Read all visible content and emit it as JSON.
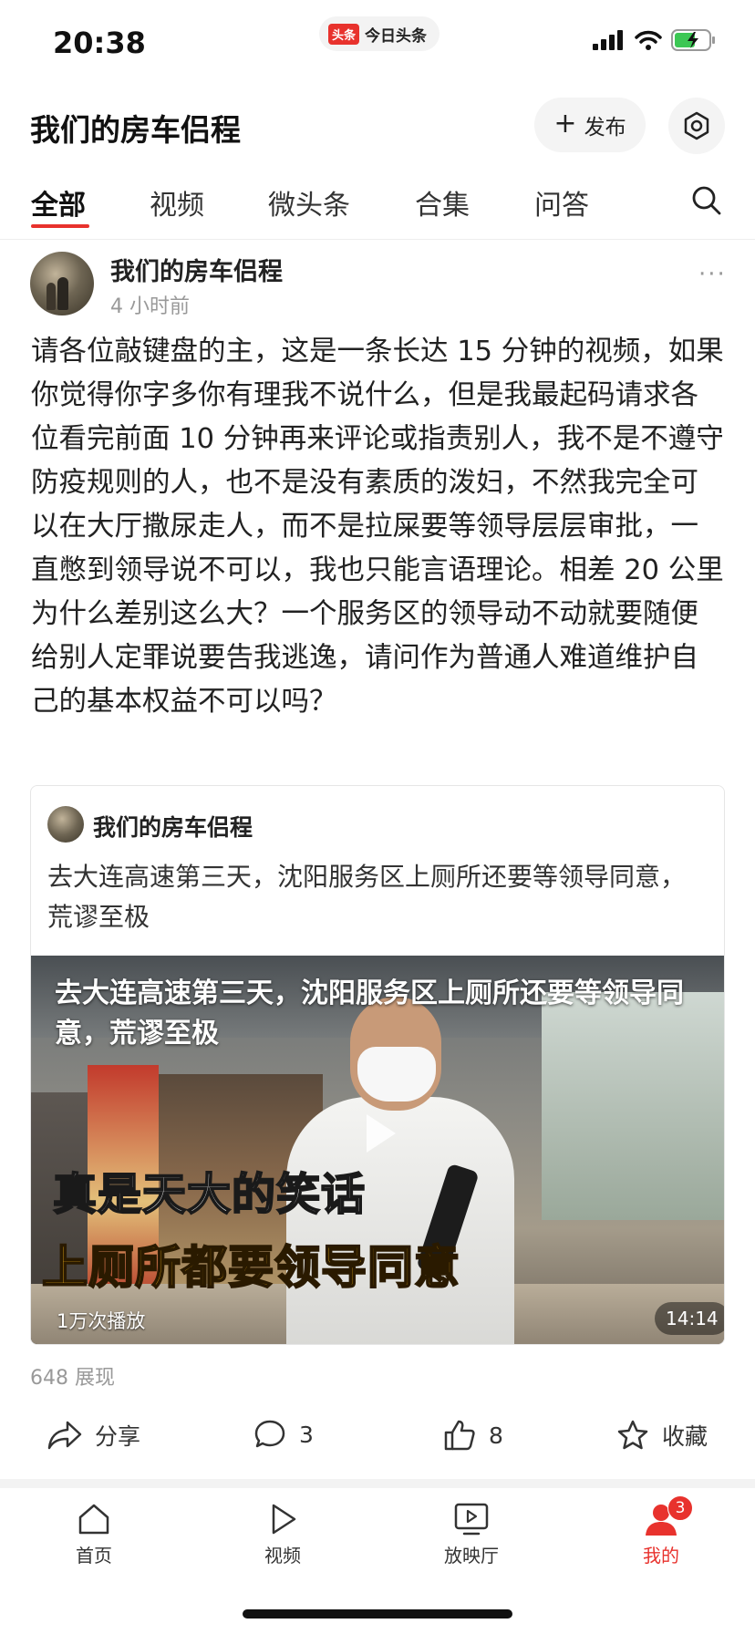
{
  "status_bar": {
    "time": "20:38",
    "app_logo": "头条",
    "app_name": "今日头条",
    "icons": [
      "signal-icon",
      "wifi-icon",
      "battery-charging-icon"
    ]
  },
  "header": {
    "title": "我们的房车侣程",
    "publish_label": "发布",
    "publish_icon": "plus-icon",
    "settings_icon": "hexagon-settings-icon"
  },
  "tabs": {
    "items": [
      {
        "label": "全部",
        "active": true
      },
      {
        "label": "视频",
        "active": false
      },
      {
        "label": "微头条",
        "active": false
      },
      {
        "label": "合集",
        "active": false
      },
      {
        "label": "问答",
        "active": false
      }
    ],
    "search_icon": "search-icon"
  },
  "post": {
    "author": "我们的房车侣程",
    "time": "4 小时前",
    "more": "···",
    "text": "请各位敲键盘的主，这是一条长达 15 分钟的视频，如果你觉得你字多你有理我不说什么，但是我最起码请求各位看完前面 10 分钟再来评论或指责别人，我不是不遵守防疫规则的人，也不是没有素质的泼妇，不然我完全可以在大厅撒尿走人，而不是拉屎要等领导层层审批，一直憋到领导说不可以，我也只能言语理论。相差 20 公里为什么差别这么大？一个服务区的领导动不动就要随便给别人定罪说要告我逃逸，请问作为普通人难道维护自己的基本权益不可以吗？",
    "quoted": {
      "author": "我们的房车侣程",
      "text": "去大连高速第三天，沈阳服务区上厕所还要等领导同意，荒谬至极",
      "video": {
        "title": "去大连高速第三天，沈阳服务区上厕所还要等领导同意，荒谬至极",
        "caption_line1": "真是天大的笑话",
        "caption_line2": "上厕所都要领导同意",
        "play_count": "1万次播放",
        "duration": "14:14"
      }
    },
    "impressions": "648 展现",
    "actions": {
      "share": "分享",
      "comments": "3",
      "likes": "8",
      "favorite": "收藏"
    }
  },
  "bottom_nav": {
    "items": [
      {
        "label": "首页",
        "icon": "home-icon"
      },
      {
        "label": "视频",
        "icon": "play-icon"
      },
      {
        "label": "放映厅",
        "icon": "screen-play-icon"
      },
      {
        "label": "我的",
        "icon": "profile-icon",
        "badge": "3",
        "active": true
      }
    ]
  },
  "colors": {
    "accent": "#e8322d",
    "caption_yellow": "#f2b21a"
  }
}
